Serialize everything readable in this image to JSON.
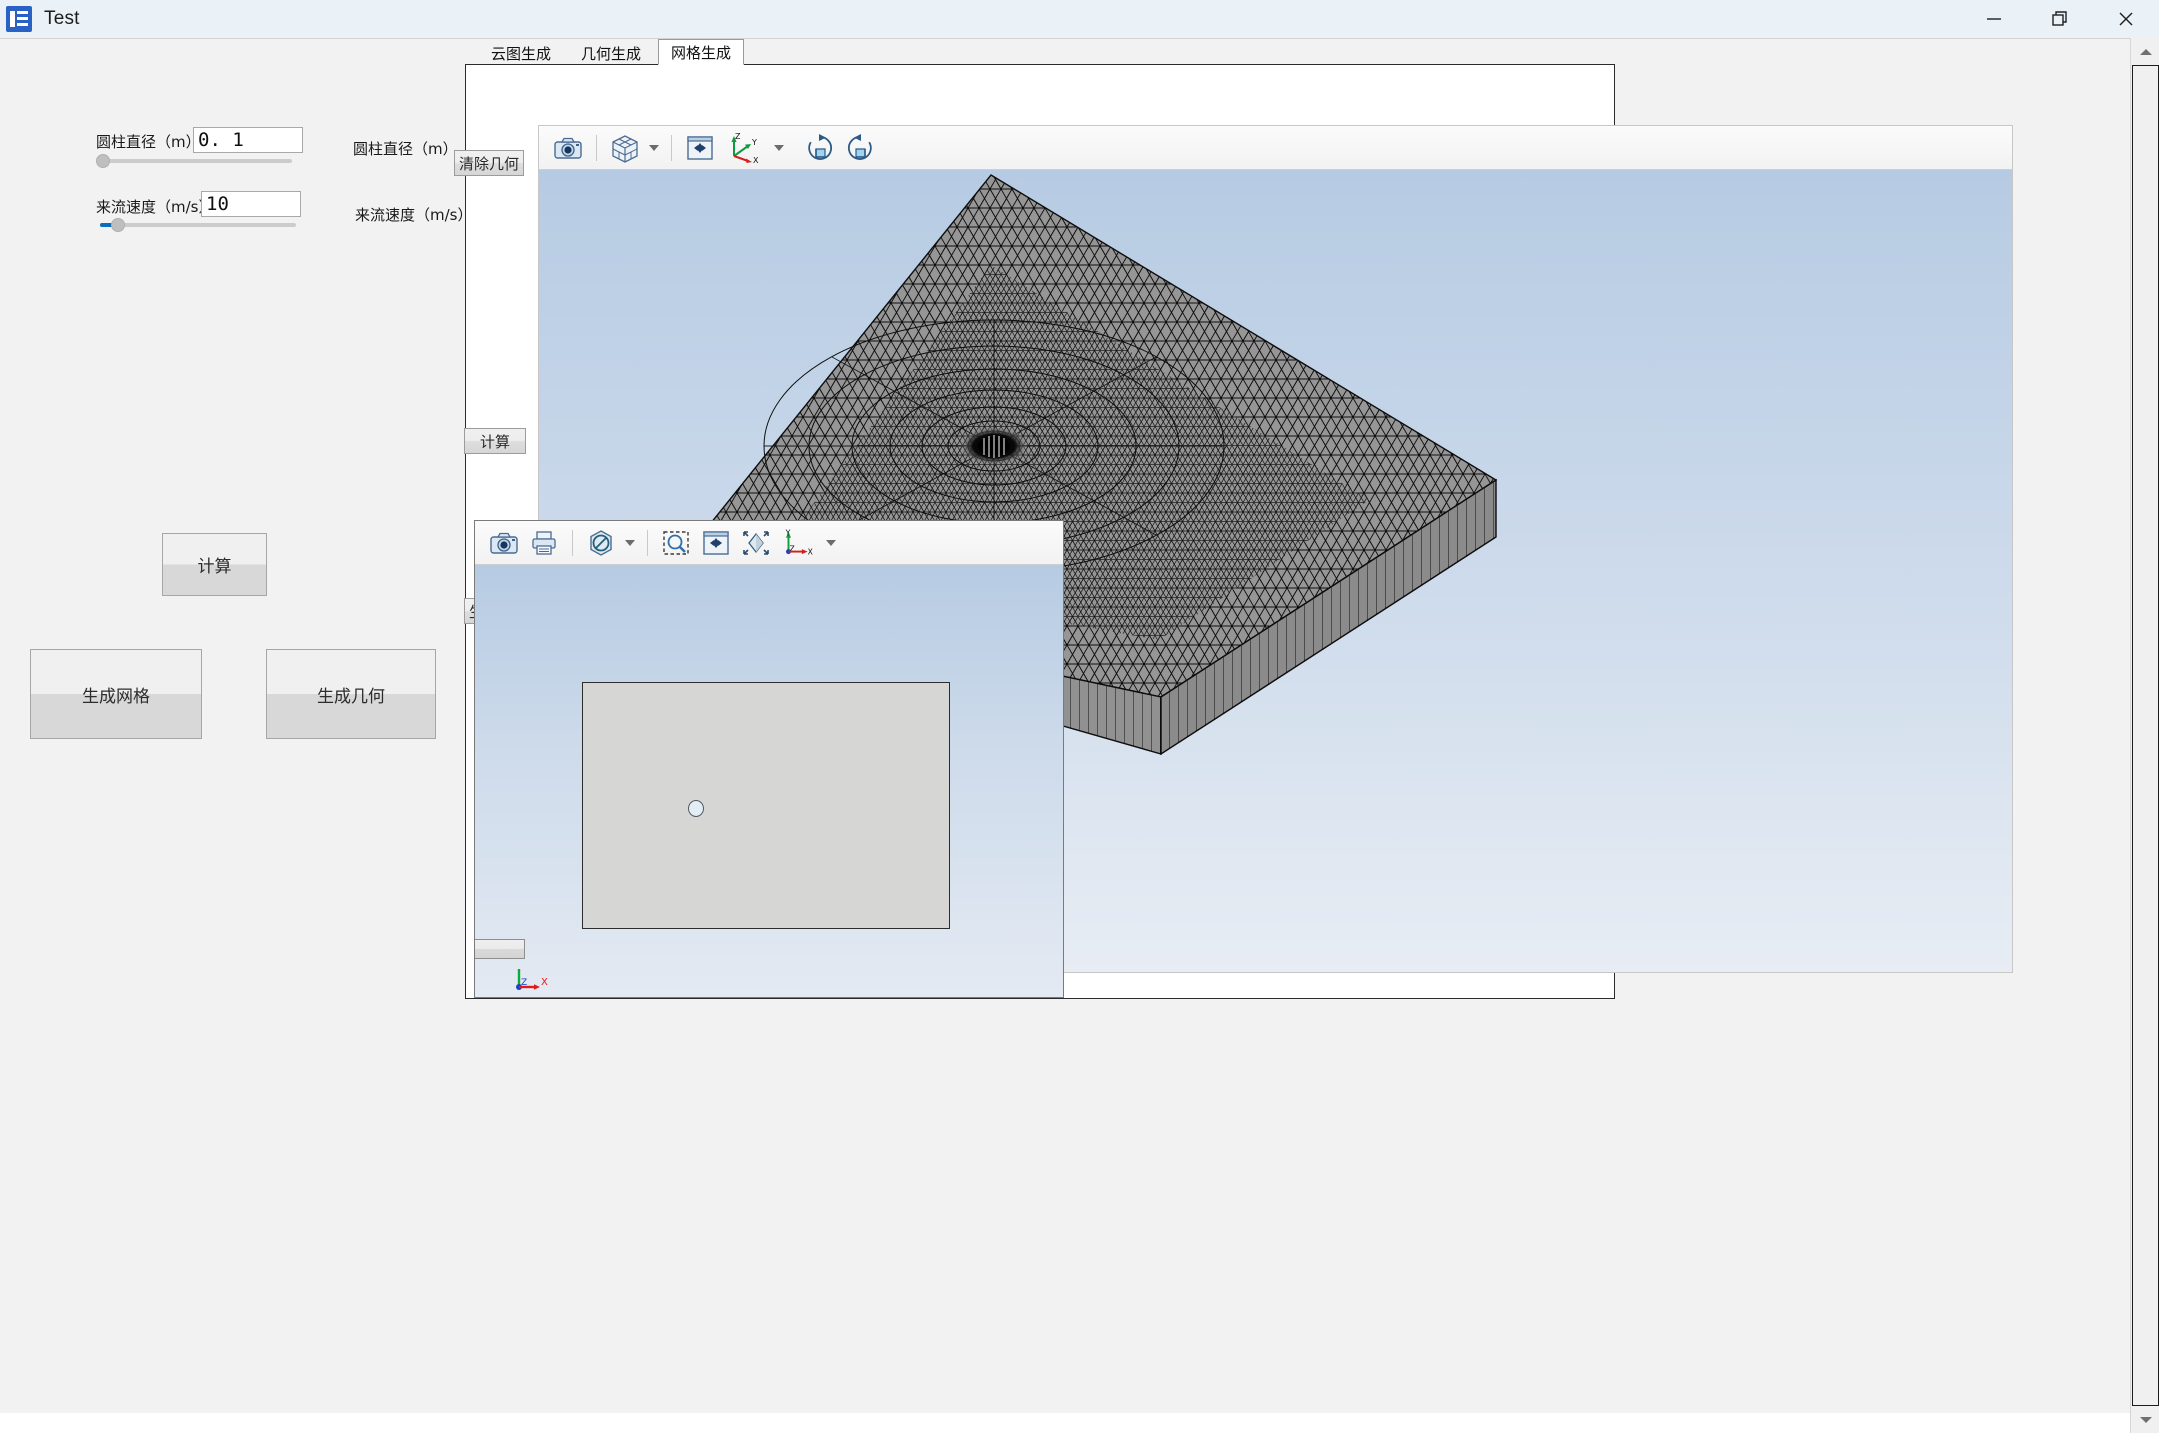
{
  "window": {
    "title": "Test",
    "app_icon": "book-stack-icon",
    "controls": [
      {
        "name": "minimize-button",
        "glyph": "minimize-icon"
      },
      {
        "name": "restore-button",
        "glyph": "restore-icon"
      },
      {
        "name": "close-button",
        "glyph": "close-icon"
      }
    ]
  },
  "left_panel": {
    "parameters": [
      {
        "label": "圆柱直径（m）",
        "value": "0. 1",
        "mirror_label": "圆柱直径（m）",
        "slider_percent": 0,
        "slider_fill_percent": 0
      },
      {
        "label": "来流速度（m/s）",
        "value": "10",
        "mirror_label": "来流速度（m/s）",
        "slider_percent": 6,
        "slider_fill_percent": 6
      }
    ],
    "buttons": [
      {
        "name": "calculate-button",
        "label": "计算"
      },
      {
        "name": "generate-mesh-button",
        "label": "生成网格"
      },
      {
        "name": "generate-geometry-button",
        "label": "生成几何"
      }
    ]
  },
  "tabs": [
    {
      "name": "tab-contour-generation",
      "label": "云图生成",
      "active": false
    },
    {
      "name": "tab-geometry-generation",
      "label": "几何生成",
      "active": false
    },
    {
      "name": "tab-mesh-generation",
      "label": "网格生成",
      "active": true
    }
  ],
  "panel_buttons": [
    {
      "name": "clear-geometry-button",
      "label": "清除几何"
    },
    {
      "name": "panel-calculate-button",
      "label": "计算"
    },
    {
      "name": "panel-generate-geometry-button",
      "label": "生成几何"
    }
  ],
  "main_viewport": {
    "name": "mesh-3d-viewport",
    "toolbar": [
      {
        "name": "screenshot-icon",
        "type": "camera"
      },
      {
        "name": "separator",
        "type": "sep"
      },
      {
        "name": "view-cube-icon",
        "type": "cube"
      },
      {
        "name": "view-cube-dropdown",
        "type": "caret"
      },
      {
        "name": "separator",
        "type": "sep"
      },
      {
        "name": "pan-fit-icon",
        "type": "pan"
      },
      {
        "name": "axis-triad-icon",
        "type": "axis-zyx"
      },
      {
        "name": "axis-triad-dropdown",
        "type": "caret"
      },
      {
        "name": "rotate-clockwise-icon",
        "type": "rotate-cw"
      },
      {
        "name": "rotate-counterclockwise-icon",
        "type": "rotate-ccw"
      }
    ],
    "background_top": "#b8cde4",
    "background_bottom": "#e6ecf4",
    "mesh_fill": "#9b9b9b",
    "mesh_line": "#101010",
    "axis_labels": [
      "Z",
      "Y",
      "X"
    ]
  },
  "inner_viewport": {
    "name": "geometry-2d-viewport",
    "toolbar": [
      {
        "name": "screenshot-icon",
        "type": "camera"
      },
      {
        "name": "print-icon",
        "type": "printer"
      },
      {
        "name": "separator",
        "type": "sep"
      },
      {
        "name": "no-selection-icon",
        "type": "prohibit"
      },
      {
        "name": "no-selection-dropdown",
        "type": "caret"
      },
      {
        "name": "separator",
        "type": "sep"
      },
      {
        "name": "zoom-box-icon",
        "type": "zoombox"
      },
      {
        "name": "pan-fit-icon",
        "type": "pan"
      },
      {
        "name": "zoom-extents-icon",
        "type": "extents"
      },
      {
        "name": "axis-triad-icon",
        "type": "axis-yzx"
      },
      {
        "name": "axis-triad-dropdown",
        "type": "caret"
      }
    ],
    "plate_fill": "#d6d6d4",
    "hole_name": "cylinder-hole",
    "axis_labels": [
      "Y",
      "Z",
      "X"
    ],
    "status_button_label": ""
  },
  "scrollbar": {
    "name": "vertical-scrollbar",
    "up_arrow": "scroll-up-icon",
    "down_arrow": "scroll-down-icon",
    "thumb_percent": 100
  }
}
